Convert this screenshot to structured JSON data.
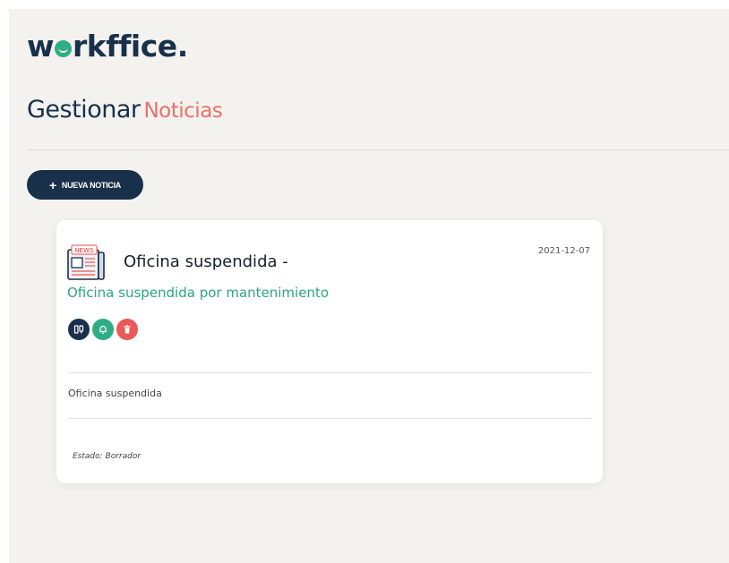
{
  "brand": {
    "logo_before": "w",
    "logo_after": "rkffice."
  },
  "header": {
    "title": "Gestionar",
    "title_accent": "Noticias"
  },
  "toolbar": {
    "new_label": "NUEVA NOTICIA",
    "new_icon": "plus-icon"
  },
  "news_items": [
    {
      "icon": "newspaper-icon",
      "icon_text": "NEWS",
      "title": "Oficina suspendida -",
      "date": "2021-12-07",
      "subtitle": "Oficina suspendida por mantenimiento",
      "actions": [
        {
          "name": "edit",
          "icon": "edit-icon",
          "color": "#18304a"
        },
        {
          "name": "notify",
          "icon": "bell-icon",
          "color": "#2fae85"
        },
        {
          "name": "delete",
          "icon": "trash-icon",
          "color": "#ec5a58"
        }
      ],
      "body": "Oficina suspendida",
      "status": "Estado: Borrador"
    }
  ],
  "colors": {
    "primary": "#18304a",
    "accent": "#ee6f6b",
    "green": "#2fae85",
    "danger": "#ec5a58",
    "background": "#f3f2ef"
  }
}
